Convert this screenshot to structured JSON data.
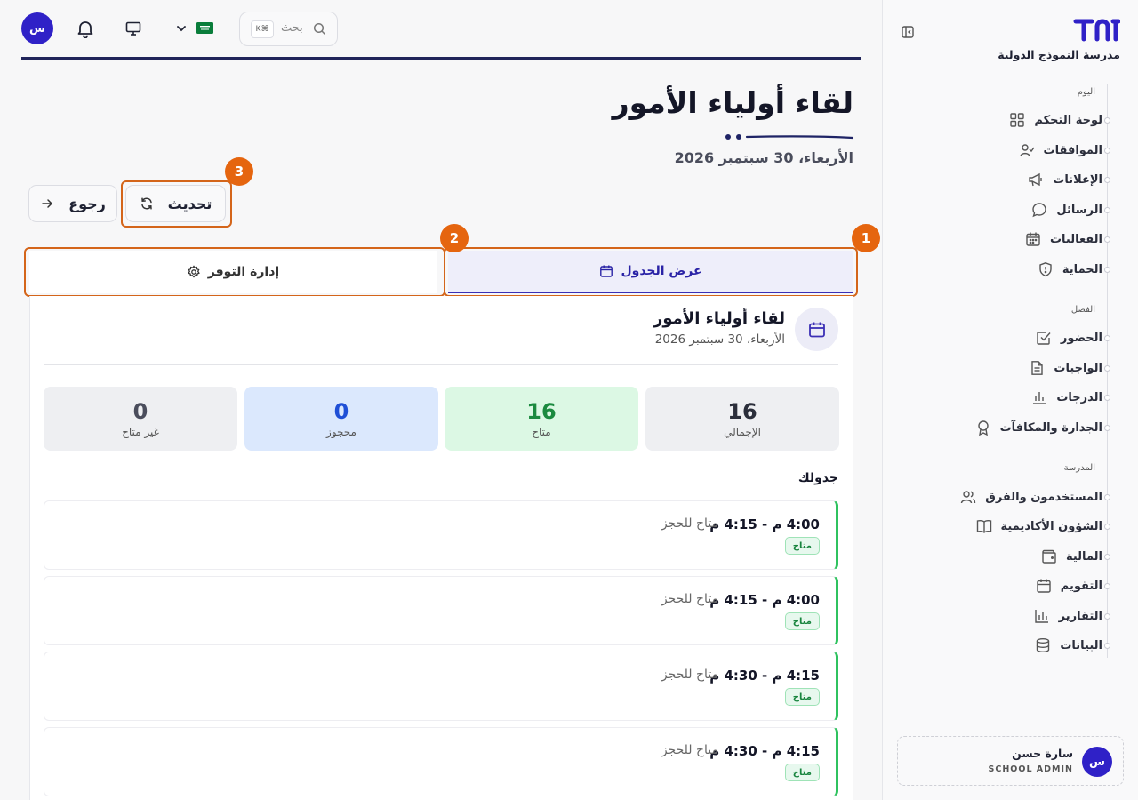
{
  "app": {
    "school_name": "مدرسة النموذج الدولية",
    "logo_icon": "brand-logo",
    "accent_color": "#2f21c7"
  },
  "topbar": {
    "avatar_initial": "س",
    "search_placeholder": "بحث",
    "search_shortcut": "K⌘",
    "icons": [
      "bell-icon",
      "monitor-icon",
      "chevron-down-icon",
      "saudi-flag-icon",
      "search-icon"
    ]
  },
  "sidebar": {
    "sections": [
      {
        "label": "اليوم",
        "items": [
          {
            "label": "لوحة التحكم",
            "icon": "dashboard-icon"
          },
          {
            "label": "الموافقات",
            "icon": "user-check-icon"
          },
          {
            "label": "الإعلانات",
            "icon": "megaphone-icon"
          },
          {
            "label": "الرسائل",
            "icon": "message-icon"
          },
          {
            "label": "الفعاليات",
            "icon": "calendar-grid-icon"
          },
          {
            "label": "الحماية",
            "icon": "shield-icon"
          }
        ]
      },
      {
        "label": "الفصل",
        "items": [
          {
            "label": "الحضور",
            "icon": "check-square-icon"
          },
          {
            "label": "الواجبات",
            "icon": "document-icon"
          },
          {
            "label": "الدرجات",
            "icon": "bar-chart-icon"
          },
          {
            "label": "الجدارة والمكافآت",
            "icon": "award-icon"
          }
        ]
      },
      {
        "label": "المدرسة",
        "items": [
          {
            "label": "المستخدمون والفرق",
            "icon": "users-icon"
          },
          {
            "label": "الشؤون الأكاديمية",
            "icon": "book-icon"
          },
          {
            "label": "المالية",
            "icon": "wallet-icon"
          },
          {
            "label": "التقويم",
            "icon": "calendar-icon"
          },
          {
            "label": "التقارير",
            "icon": "chart-icon"
          },
          {
            "label": "البيانات",
            "icon": "database-icon"
          }
        ]
      }
    ],
    "user": {
      "initial": "س",
      "name": "سارة حسن",
      "role": "SCHOOL ADMIN"
    }
  },
  "page": {
    "title": "لقاء أولياء الأمور",
    "date": "الأربعاء، 30 سبتمبر 2026",
    "buttons": {
      "refresh": "تحديث",
      "back": "رجوع"
    },
    "tabs": {
      "schedule": "عرض الجدول",
      "availability": "إدارة التوفر"
    },
    "annotations": {
      "tab_schedule": "1",
      "tab_availability": "2",
      "refresh_button": "3"
    }
  },
  "event": {
    "title": "لقاء أولياء الأمور",
    "date": "الأربعاء، 30 سبتمبر 2026"
  },
  "stats": [
    {
      "value": "16",
      "label": "الإجمالي",
      "bg": "#eeeff2",
      "color": "#2b2e3b"
    },
    {
      "value": "16",
      "label": "متاح",
      "bg": "#dcf8e4",
      "color": "#1b8a3f"
    },
    {
      "value": "0",
      "label": "محجوز",
      "bg": "#dbe8fd",
      "color": "#1f4fd6"
    },
    {
      "value": "0",
      "label": "غير متاح",
      "bg": "#eeeff2",
      "color": "#4a4d5c"
    }
  ],
  "schedule": {
    "heading": "جدولك",
    "slots": [
      {
        "time": "4:00 م - 4:15 م",
        "status": "متاح للحجز",
        "badge": "متاح"
      },
      {
        "time": "4:00 م - 4:15 م",
        "status": "متاح للحجز",
        "badge": "متاح"
      },
      {
        "time": "4:15 م - 4:30 م",
        "status": "متاح للحجز",
        "badge": "متاح"
      },
      {
        "time": "4:15 م - 4:30 م",
        "status": "متاح للحجز",
        "badge": "متاح"
      }
    ]
  }
}
